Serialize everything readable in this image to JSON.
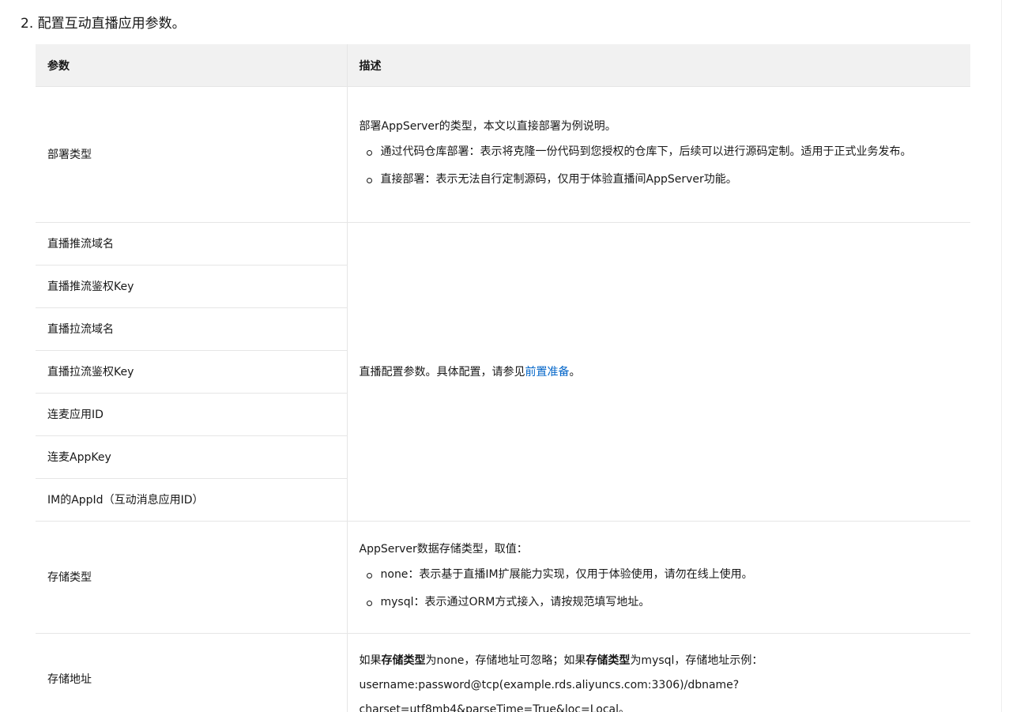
{
  "heading": "2. 配置互动直播应用参数。",
  "table": {
    "col_param": "参数",
    "col_desc": "描述",
    "deploy": {
      "name": "部署类型",
      "intro": "部署AppServer的类型，本文以直接部署为例说明。",
      "option1": "通过代码仓库部署：表示将克隆一份代码到您授权的仓库下，后续可以进行源码定制。适用于正式业务发布。",
      "option2": "直接部署：表示无法自行定制源码，仅用于体验直播间AppServer功能。"
    },
    "live_params": [
      "直播推流域名",
      "直播推流鉴权Key",
      "直播拉流域名",
      "直播拉流鉴权Key",
      "连麦应用ID",
      "连麦AppKey",
      "IM的AppId（互动消息应用ID）"
    ],
    "live_desc_before": "直播配置参数。具体配置，请参见",
    "live_desc_link": "前置准备",
    "live_desc_after": "。",
    "storage_type": {
      "name": "存储类型",
      "intro": "AppServer数据存储类型，取值：",
      "option1": "none：表示基于直播IM扩展能力实现，仅用于体验使用，请勿在线上使用。",
      "option2": "mysql：表示通过ORM方式接入，请按规范填写地址。"
    },
    "storage_addr": {
      "name": "存储地址",
      "part1": "如果",
      "bold1": "存储类型",
      "part2": "为none，存储地址可忽略；如果",
      "bold2": "存储类型",
      "part3": "为mysql，存储地址示例：",
      "line2": "username:password@tcp(example.rds.aliyuncs.com:3306)/dbname?",
      "line3": "charset=utf8mb4&parseTime=True&loc=Local。"
    }
  }
}
